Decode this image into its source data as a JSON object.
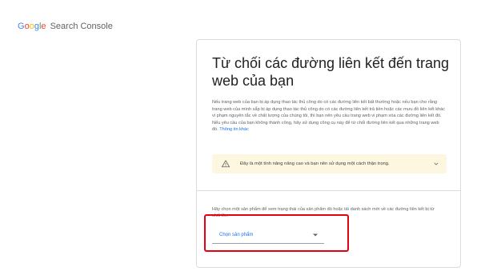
{
  "header": {
    "logo_letters": [
      "G",
      "o",
      "o",
      "g",
      "l",
      "e"
    ],
    "product_name": "Search Console"
  },
  "card": {
    "title": "Từ chối các đường liên kết đến trang web của bạn",
    "description": "Nếu trang web của bạn bị áp dụng thao tác thủ công do có các đường liên kết bất thường hoặc nếu bạn cho rằng trang web của mình sắp bị áp dụng thao tác thủ công do có các đường liên kết trả tiền hoặc các mưu đồ liên kết khác vi phạm nguyên tắc về chất lượng của chúng tôi, thì bạn nên yêu cầu trang web vi phạm xóa các đường liên kết đó. Nếu yêu cầu của bạn không thành công, hãy sử dụng công cụ này để từ chối đường liên kết qua những trang web đó.",
    "more_info_link": "Thông tin khác",
    "warning": {
      "icon": "warning-icon",
      "text": "Đây là một tính năng nâng cao và bạn nên sử dụng một cách thận trọng.",
      "expand_icon": "chevron-down-icon"
    },
    "select_section": {
      "label": "Hãy chọn một sản phẩm để xem trạng thái của sản phẩm đó hoặc tải danh sách mới về các đường liên kết bị từ chối lên",
      "selected_value": "Chọn sản phẩm",
      "caret_icon": "dropdown-caret-icon"
    }
  },
  "colors": {
    "accent": "#1a73e8",
    "warning_bg": "#fef7e0",
    "highlight": "#e3000f"
  }
}
